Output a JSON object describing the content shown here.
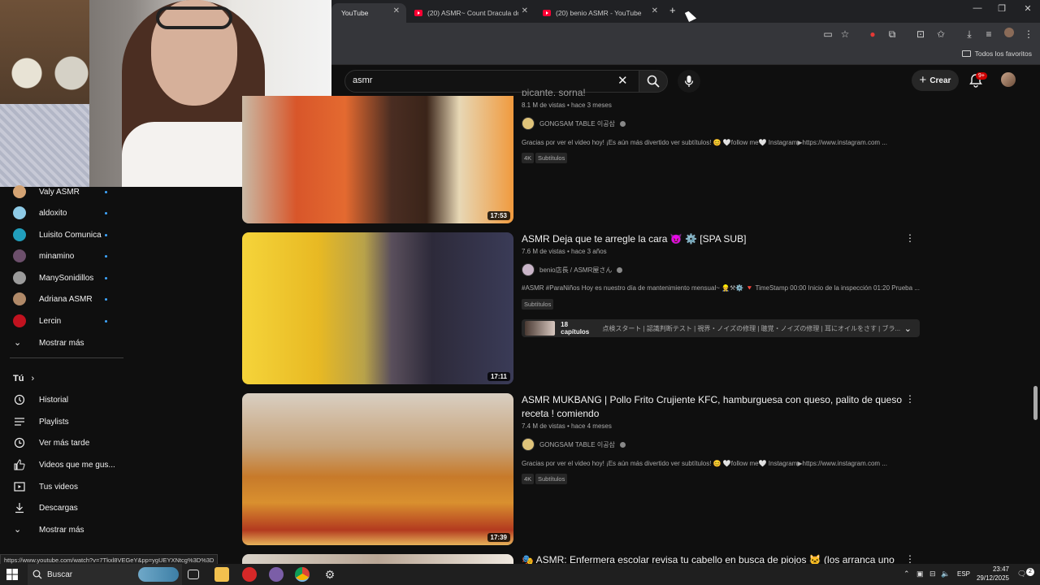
{
  "browser": {
    "tabs": [
      {
        "title": "YouTube",
        "active": true
      },
      {
        "title": "(20) ASMR~ Count Dracula doe",
        "active": false
      },
      {
        "title": "(20) benio ASMR - YouTube",
        "active": false
      }
    ],
    "new_tab_label": "+",
    "window_controls": {
      "minimize": "—",
      "restore": "❐",
      "close": "✕"
    },
    "bookmarks_folder_label": "Todos los favoritos"
  },
  "yt_header": {
    "search_value": "asmr",
    "create_label": "Crear",
    "notification_count": "9+"
  },
  "sidebar": {
    "subscriptions": [
      {
        "label": "Valy ASMR",
        "color": "#d4a373"
      },
      {
        "label": "aldoxito",
        "color": "#8ecae6"
      },
      {
        "label": "Luisito Comunica",
        "color": "#219ebc"
      },
      {
        "label": "minamino",
        "color": "#6c4f6b"
      },
      {
        "label": "ManySonidillos",
        "color": "#9b9b9b"
      },
      {
        "label": "Adriana ASMR",
        "color": "#b08968"
      },
      {
        "label": "Lercin",
        "color": "#c1121f"
      }
    ],
    "show_more_1": "Mostrar más",
    "you_heading": "Tú",
    "you_items": [
      {
        "label": "Historial",
        "icon": "history-icon"
      },
      {
        "label": "Playlists",
        "icon": "playlists-icon"
      },
      {
        "label": "Ver más tarde",
        "icon": "watch-later-icon"
      },
      {
        "label": "Videos que me gus...",
        "icon": "thumbs-up-icon"
      },
      {
        "label": "Tus videos",
        "icon": "your-videos-icon"
      },
      {
        "label": "Descargas",
        "icon": "download-icon"
      }
    ],
    "show_more_2": "Mostrar más"
  },
  "results": [
    {
      "title_partial": "picante, sorna!",
      "meta": "8.1 M de vistas • hace 3 meses",
      "channel": "GONGSAM TABLE 이공삼",
      "description": "Gracias por ver el video hoy! ¡Es aún más divertido ver subtítulos! 😊 🤍follow me🤍 Instagram▶https://www.instagram.com ...",
      "badges": [
        "4K",
        "Subtítulos"
      ],
      "duration": "17:53"
    },
    {
      "title": "ASMR Deja que te arregle la cara 😈 ⚙️ [SPA SUB]",
      "meta": "7.6 M de vistas • hace 3 años",
      "channel": "benio店長 / ASMR屋さん",
      "description": "#ASMR #ParaNiños Hoy es nuestro día de mantenimiento mensual~ 👷⚒⚙️ 🔻 TimeStamp 00:00 Inicio de la inspección 01:20 Prueba ...",
      "badges": [
        "Subtítulos"
      ],
      "chapters_label": "18 capítulos",
      "chapters_desc": "点検スタート | 認識判断テスト | 視界・ノイズの修理 | 聴覚・ノイズの修理 | 耳にオイルをさす | ブラ...",
      "duration": "17:11"
    },
    {
      "title": "ASMR MUKBANG | Pollo Frito Crujiente KFC, hamburguesa con queso, palito de queso receta ! comiendo",
      "meta": "7.4 M de vistas • hace 4 meses",
      "channel": "GONGSAM TABLE 이공삼",
      "description": "Gracias por ver el video hoy! ¡Es aún más divertido ver subtítulos! 😊 🤍follow me🤍 Instagram▶https://www.instagram.com ...",
      "badges": [
        "4K",
        "Subtítulos"
      ],
      "duration": "17:39"
    },
    {
      "title": "🎭 ASMR: Enfermera escolar revisa tu cabello en busca de piojos 🐱 (los arranca uno"
    }
  ],
  "status_url": "https://www.youtube.com/watch?v=7Tkxl8VEGeY&pp=ygUEYXNtcg%3D%3D",
  "taskbar": {
    "search_label": "Buscar",
    "language": "ESP",
    "time": "23:47",
    "date": "29/12/2025",
    "notification_count": "2"
  },
  "colors": {
    "accent_red": "#ff0033",
    "link_blue": "#3ea6ff",
    "background": "#0f0f0f"
  }
}
